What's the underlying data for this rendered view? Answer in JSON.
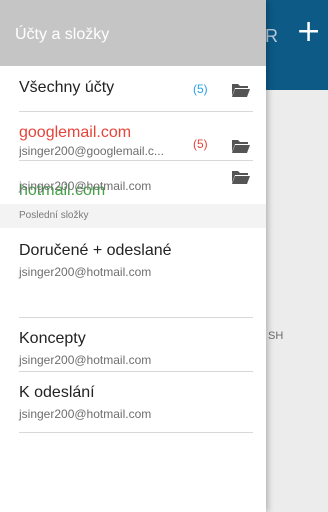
{
  "background": {
    "plus_label": "+",
    "partial_letter": "R",
    "partial_text": "SH"
  },
  "drawer": {
    "title": "Účty a složky",
    "accounts": [
      {
        "name": "Všechny účty",
        "email": "",
        "count": "(5)",
        "color": "#222222",
        "count_color": "#2aa3e4"
      },
      {
        "name": "googlemail.com",
        "email": "jsinger200@googlemail.c...",
        "count": "(5)",
        "color": "#e5443a",
        "count_color": "#e5443a"
      },
      {
        "name": "hotmail.com",
        "email": "jsinger200@hotmail.com",
        "count": "",
        "color": "#43a047",
        "count_color": "#43a047"
      }
    ],
    "section_label": "Poslední složky",
    "folders": [
      {
        "name": "Doručené + odeslané",
        "email": "jsinger200@hotmail.com"
      },
      {
        "name": "Koncepty",
        "email": "jsinger200@hotmail.com"
      },
      {
        "name": "K odeslání",
        "email": "jsinger200@hotmail.com"
      }
    ]
  }
}
